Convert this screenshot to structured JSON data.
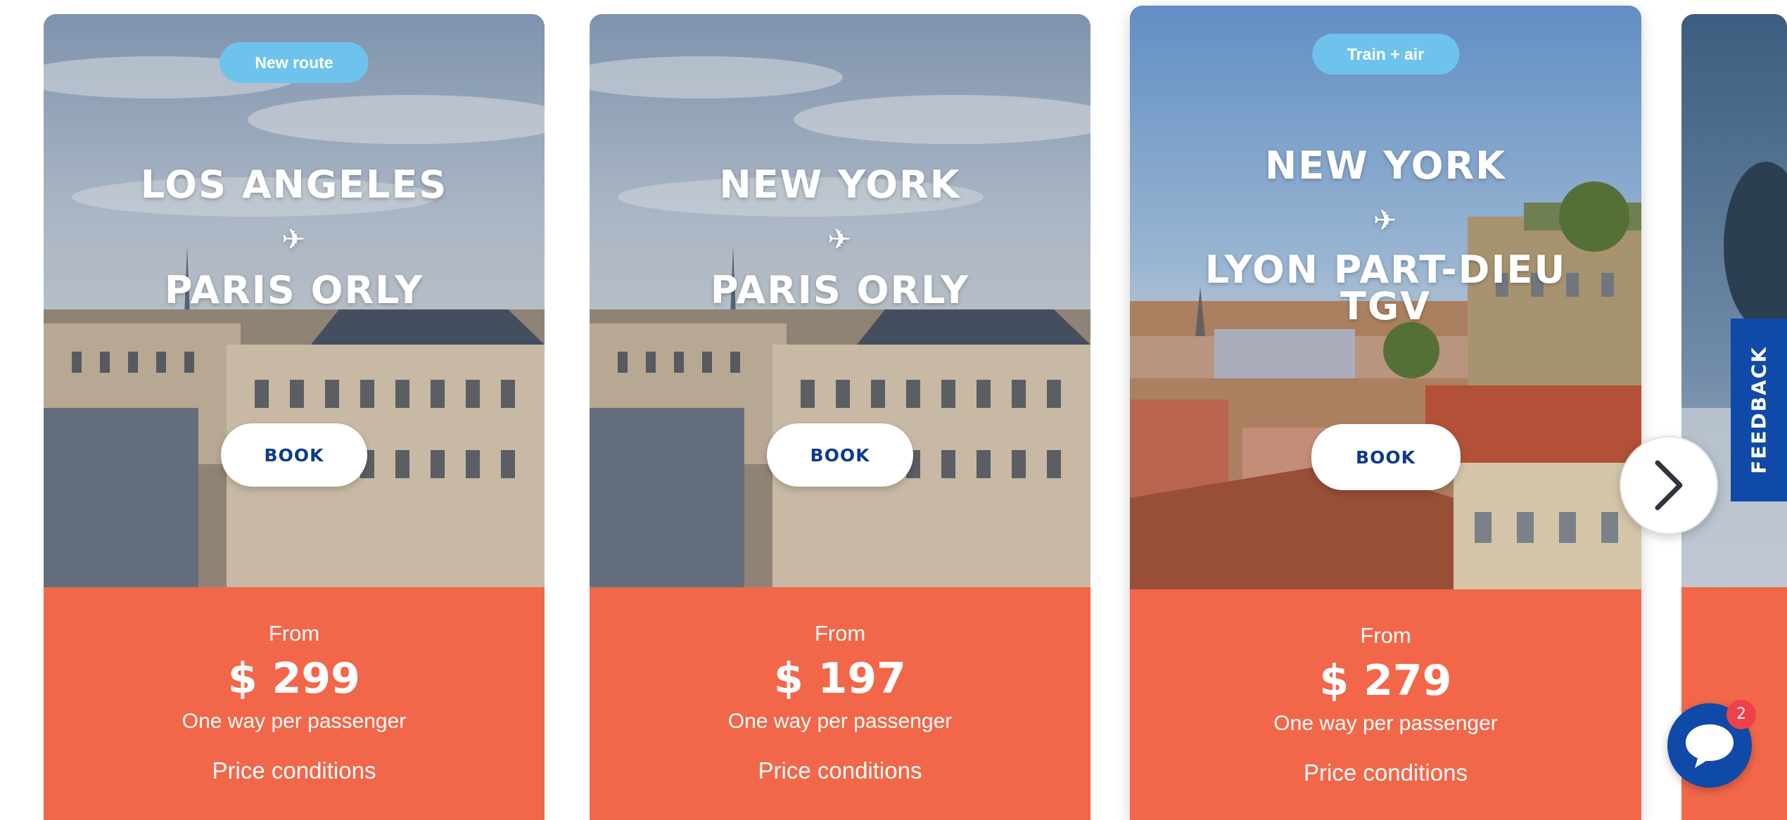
{
  "cards": [
    {
      "badge": "New route",
      "origin": "LOS ANGELES",
      "plane_icon": "✈",
      "destination": "PARIS ORLY",
      "book_label": "BOOK",
      "from_label": "From",
      "price": "$ 299",
      "fare_note": "One way per passenger",
      "conditions_label": "Price conditions"
    },
    {
      "origin": "NEW YORK",
      "plane_icon": "✈",
      "destination": "PARIS ORLY",
      "book_label": "BOOK",
      "from_label": "From",
      "price": "$ 197",
      "fare_note": "One way per passenger",
      "conditions_label": "Price conditions"
    },
    {
      "badge": "Train + air",
      "origin": "NEW YORK",
      "plane_icon": "✈",
      "destination": "LYON PART-DIEU TGV",
      "book_label": "BOOK",
      "from_label": "From",
      "price": "$ 279",
      "fare_note": "One way per passenger",
      "conditions_label": "Price conditions"
    }
  ],
  "feedback_label": "FEEDBACK",
  "chat": {
    "icon": "chat-bubble-icon",
    "unread_count": "2"
  },
  "colors": {
    "price_panel": "#f26749",
    "badge": "#6ec3ec",
    "brand_blue": "#0f4aa8",
    "book_text": "#0d3b8c",
    "notification": "#f0404a"
  }
}
